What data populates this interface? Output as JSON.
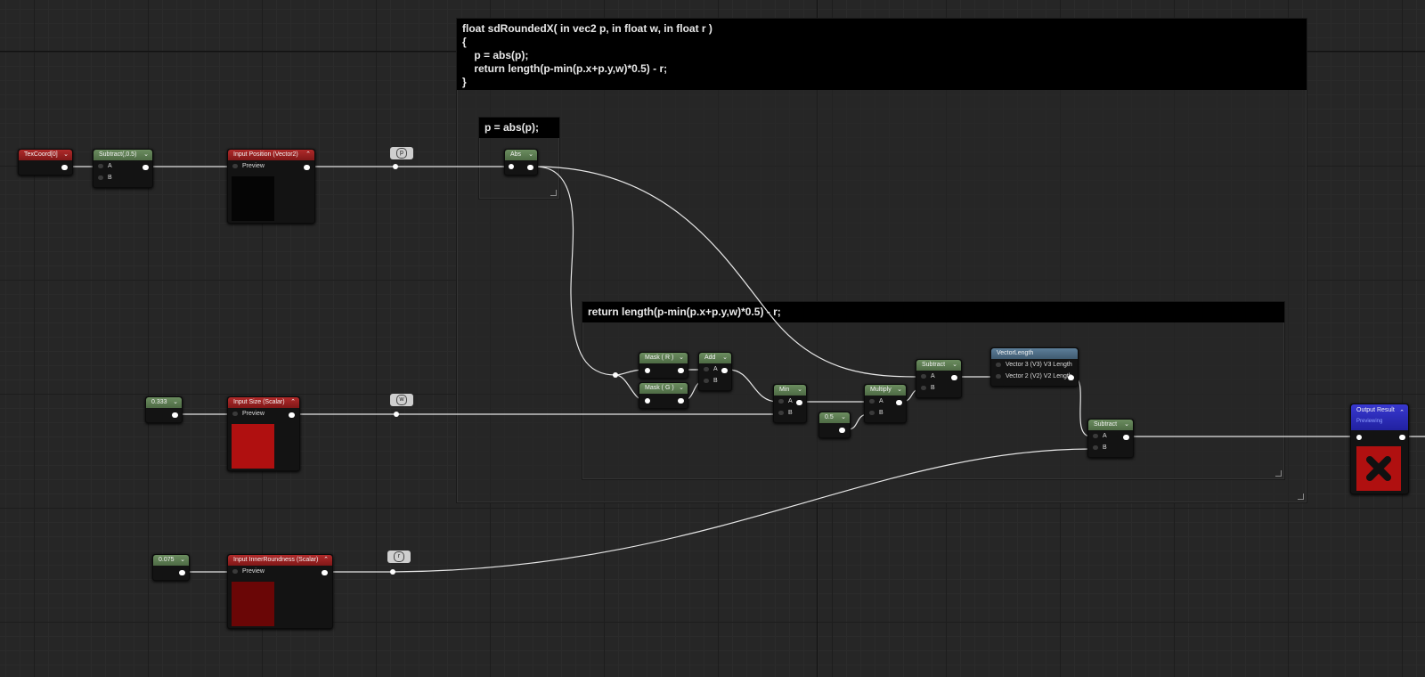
{
  "comments": {
    "main_title": "float sdRoundedX( in vec2 p, in float w, in float r )\n{\n    p = abs(p);\n    return length(p-min(p.x+p.y,w)*0.5) - r;\n}",
    "abs_title": "p = abs(p);",
    "return_title": "return length(p-min(p.x+p.y,w)*0.5) - r;"
  },
  "nodes": {
    "texcoord": {
      "title": "TexCoord[0]"
    },
    "subtract_const": {
      "title": "Subtract(,0.5)",
      "pin_a": "A",
      "pin_b": "B"
    },
    "input_position": {
      "title": "Input Position (Vector2)",
      "pin": "Preview"
    },
    "abs": {
      "title": "Abs"
    },
    "const_w": {
      "title": "0.333"
    },
    "input_size": {
      "title": "Input Size (Scalar)",
      "pin": "Preview"
    },
    "const_r": {
      "title": "0.075"
    },
    "input_roundness": {
      "title": "Input InnerRoundness (Scalar)",
      "pin": "Preview"
    },
    "mask_r": {
      "title": "Mask ( R )"
    },
    "mask_g": {
      "title": "Mask ( G )"
    },
    "add": {
      "title": "Add",
      "pin_a": "A",
      "pin_b": "B"
    },
    "min": {
      "title": "Min",
      "pin_a": "A",
      "pin_b": "B"
    },
    "const_half": {
      "title": "0.5"
    },
    "multiply": {
      "title": "Multiply",
      "pin_a": "A",
      "pin_b": "B"
    },
    "subtract1": {
      "title": "Subtract",
      "pin_a": "A",
      "pin_b": "B"
    },
    "vector_length": {
      "title": "VectorLength",
      "pin_v3": "Vector 3 (V3) V3 Length",
      "pin_v2": "Vector 2 (V2) V2 Length"
    },
    "subtract2": {
      "title": "Subtract",
      "pin_a": "A",
      "pin_b": "B"
    },
    "output": {
      "title": "Output Result",
      "subtitle": "Previewing"
    }
  },
  "reroutes": {
    "p": "p",
    "w": "w",
    "r": "r"
  },
  "colors": {
    "wire": "#e6e6e6",
    "size_preview": "#b01010",
    "roundness_preview": "#6a0606",
    "output_preview": "#b01010"
  }
}
